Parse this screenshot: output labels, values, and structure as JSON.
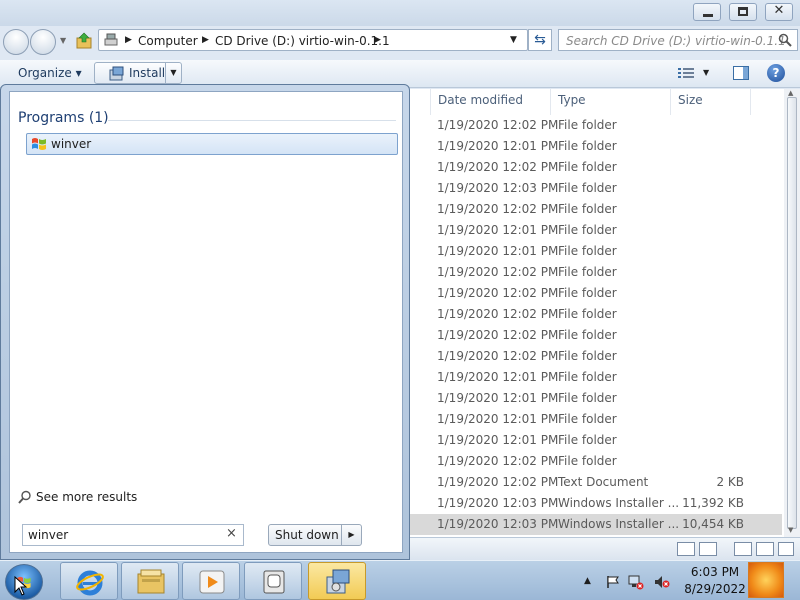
{
  "address": {
    "crumbs": [
      "Computer",
      "CD Drive (D:) virtio-win-0.1.1"
    ]
  },
  "search": {
    "placeholder": "Search CD Drive (D:) virtio-win-0.1.1"
  },
  "toolbar": {
    "organize_label": "Organize ▾",
    "install_label": "Install"
  },
  "columns": {
    "date": "Date modified",
    "type": "Type",
    "size": "Size"
  },
  "rows": [
    {
      "date": "1/19/2020 12:02 PM",
      "type": "File folder",
      "size": ""
    },
    {
      "date": "1/19/2020 12:01 PM",
      "type": "File folder",
      "size": ""
    },
    {
      "date": "1/19/2020 12:02 PM",
      "type": "File folder",
      "size": ""
    },
    {
      "date": "1/19/2020 12:03 PM",
      "type": "File folder",
      "size": ""
    },
    {
      "date": "1/19/2020 12:02 PM",
      "type": "File folder",
      "size": ""
    },
    {
      "date": "1/19/2020 12:01 PM",
      "type": "File folder",
      "size": ""
    },
    {
      "date": "1/19/2020 12:01 PM",
      "type": "File folder",
      "size": ""
    },
    {
      "date": "1/19/2020 12:02 PM",
      "type": "File folder",
      "size": ""
    },
    {
      "date": "1/19/2020 12:02 PM",
      "type": "File folder",
      "size": ""
    },
    {
      "date": "1/19/2020 12:02 PM",
      "type": "File folder",
      "size": ""
    },
    {
      "date": "1/19/2020 12:02 PM",
      "type": "File folder",
      "size": ""
    },
    {
      "date": "1/19/2020 12:02 PM",
      "type": "File folder",
      "size": ""
    },
    {
      "date": "1/19/2020 12:01 PM",
      "type": "File folder",
      "size": ""
    },
    {
      "date": "1/19/2020 12:01 PM",
      "type": "File folder",
      "size": ""
    },
    {
      "date": "1/19/2020 12:01 PM",
      "type": "File folder",
      "size": ""
    },
    {
      "date": "1/19/2020 12:01 PM",
      "type": "File folder",
      "size": ""
    },
    {
      "date": "1/19/2020 12:02 PM",
      "type": "File folder",
      "size": ""
    },
    {
      "date": "1/19/2020 12:02 PM",
      "type": "Text Document",
      "size": "2 KB"
    },
    {
      "date": "1/19/2020 12:03 PM",
      "type": "Windows Installer ...",
      "size": "11,392 KB"
    },
    {
      "date": "1/19/2020 12:03 PM",
      "type": "Windows Installer ...",
      "size": "10,454 KB",
      "selected": true
    }
  ],
  "startmenu": {
    "programs_header": "Programs (1)",
    "results": [
      {
        "label": "winver",
        "icon": "windows-flag-icon"
      }
    ],
    "see_more": "See more results",
    "search_value": "winver",
    "clear_glyph": "×",
    "shutdown_label": "Shut down"
  },
  "taskbar": {
    "pinned": [
      "internet-explorer-icon",
      "windows-explorer-icon",
      "media-player-icon",
      "device-manager-icon",
      "installer-icon"
    ],
    "active_index": 4
  },
  "clock": {
    "time": "6:03 PM",
    "date": "8/29/2022"
  },
  "colors": {
    "accent": "#3a6ea5",
    "selection": "#d9d9d9",
    "taskbar": "#9bb7d6"
  }
}
